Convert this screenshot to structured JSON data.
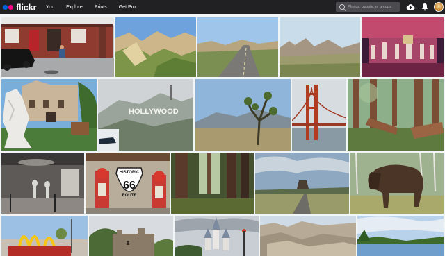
{
  "header": {
    "logo_text": "flickr",
    "nav": [
      "You",
      "Explore",
      "Prints",
      "Get Pro"
    ],
    "search_placeholder": "Photos, people, or groups",
    "upload_icon": "cloud-upload-icon",
    "notifications_icon": "bell-icon",
    "avatar_icon": "user-avatar"
  },
  "colors": {
    "topbar": "#212124",
    "logo_blue": "#0063dc",
    "logo_pink": "#ff0084",
    "background": "#f2f5f6"
  },
  "photos": {
    "hollywood_sign_text": "HOLLYWOOD",
    "route66_sign": {
      "top": "HISTORIC",
      "number": "66",
      "bottom": "ROUTE"
    }
  }
}
